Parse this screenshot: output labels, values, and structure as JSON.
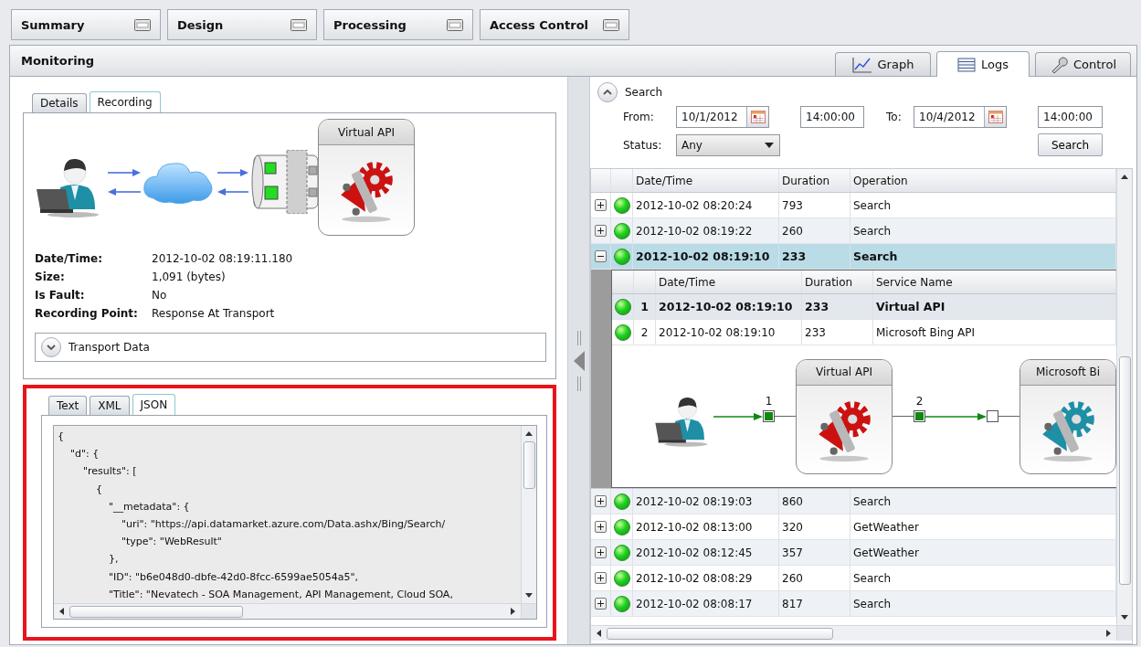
{
  "nav_tabs": [
    "Summary",
    "Design",
    "Processing",
    "Access Control"
  ],
  "panel": {
    "title": "Monitoring"
  },
  "left": {
    "tabs": [
      {
        "label": "Details",
        "selected": false
      },
      {
        "label": "Recording",
        "selected": true
      }
    ],
    "recording": {
      "service_title": "Virtual API"
    },
    "details": [
      {
        "label": "Date/Time:",
        "value": "2012-10-02 08:19:11.180"
      },
      {
        "label": "Size:",
        "value": "1,091 (bytes)"
      },
      {
        "label": "Is Fault:",
        "value": "No"
      },
      {
        "label": "Recording Point:",
        "value": "Response At Transport"
      }
    ],
    "transport": {
      "label": "Transport Data",
      "expanded": false
    },
    "content_tabs": [
      {
        "label": "Text",
        "selected": false
      },
      {
        "label": "XML",
        "selected": false
      },
      {
        "label": "JSON",
        "selected": true
      }
    ],
    "content_lines": [
      "{",
      "    \"d\": {",
      "        \"results\": [",
      "            {",
      "                \"__metadata\": {",
      "                    \"uri\": \"https://api.datamarket.azure.com/Data.ashx/Bing/Search/",
      "                    \"type\": \"WebResult\"",
      "                },",
      "                \"ID\": \"b6e048d0-dbfe-42d0-8fcc-6599ae5054a5\",",
      "                \"Title\": \"Nevatech - SOA Management, API Management, Cloud SOA,"
    ]
  },
  "right": {
    "tabs": [
      {
        "kind": "graph",
        "label": "Graph",
        "selected": false
      },
      {
        "kind": "logs",
        "label": "Logs",
        "selected": true
      },
      {
        "kind": "control",
        "label": "Control",
        "selected": false
      }
    ],
    "search": {
      "label": "Search",
      "expanded": true,
      "from_label": "From:",
      "from_date": "10/1/2012",
      "from_time": "14:00:00",
      "to_label": "To:",
      "to_date": "10/4/2012",
      "to_time": "14:00:00",
      "status_label": "Status:",
      "status_value": "Any",
      "button": "Search"
    },
    "table": {
      "columns": [
        "Date/Time",
        "Duration",
        "Operation"
      ],
      "rows": [
        {
          "expanded": false,
          "selected": false,
          "datetime": "2012-10-02 08:20:24",
          "duration": "793",
          "operation": "Search"
        },
        {
          "expanded": false,
          "selected": false,
          "datetime": "2012-10-02 08:19:22",
          "duration": "260",
          "operation": "Search"
        },
        {
          "expanded": true,
          "selected": true,
          "datetime": "2012-10-02 08:19:10",
          "duration": "233",
          "operation": "Search",
          "detail": {
            "columns": [
              "Date/Time",
              "Duration",
              "Service Name"
            ],
            "rows": [
              {
                "index": "1",
                "selected": true,
                "datetime": "2012-10-02 08:19:10",
                "duration": "233",
                "service": "Virtual API"
              },
              {
                "index": "2",
                "selected": false,
                "datetime": "2012-10-02 08:19:10",
                "duration": "233",
                "service": "Microsoft Bing API"
              }
            ],
            "flow": {
              "ports": [
                {
                  "label": "1",
                  "active": true
                },
                {
                  "label": "2",
                  "active": true
                },
                {
                  "active": false
                }
              ],
              "nodes": [
                {
                  "title": "Virtual API",
                  "color": "#cc1111"
                },
                {
                  "title": "Microsoft Bi",
                  "color": "#1f8fa6"
                }
              ]
            }
          }
        },
        {
          "expanded": false,
          "selected": false,
          "datetime": "2012-10-02 08:19:03",
          "duration": "860",
          "operation": "Search"
        },
        {
          "expanded": false,
          "selected": false,
          "datetime": "2012-10-02 08:13:00",
          "duration": "320",
          "operation": "GetWeather"
        },
        {
          "expanded": false,
          "selected": false,
          "datetime": "2012-10-02 08:12:45",
          "duration": "357",
          "operation": "GetWeather"
        },
        {
          "expanded": false,
          "selected": false,
          "datetime": "2012-10-02 08:08:29",
          "duration": "260",
          "operation": "Search"
        },
        {
          "expanded": false,
          "selected": false,
          "datetime": "2012-10-02 08:08:17",
          "duration": "817",
          "operation": "Search"
        }
      ]
    }
  }
}
